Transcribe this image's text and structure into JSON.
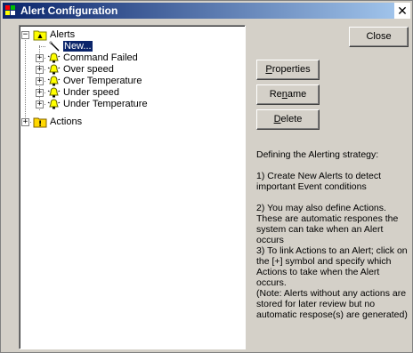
{
  "window": {
    "title": "Alert Configuration",
    "close_glyph": "✕"
  },
  "tree": {
    "root_alerts": "Alerts",
    "new_item": "New...",
    "alert_items": [
      "Command Failed",
      "Over speed",
      "Over Temperature",
      "Under speed",
      "Under Temperature"
    ],
    "root_actions": "Actions"
  },
  "buttons": {
    "close": "Close",
    "properties_pre": "",
    "properties_key": "P",
    "properties_post": "roperties",
    "rename_pre": "Re",
    "rename_key": "n",
    "rename_post": "ame",
    "delete_pre": "",
    "delete_key": "D",
    "delete_post": "elete"
  },
  "help": {
    "heading": "Defining the Alerting strategy:",
    "step1": "1) Create New Alerts to detect important Event conditions",
    "step2": "2) You may also define Actions. These are automatic respones the system can take when an Alert occurs",
    "step3": "3) To link Actions to an Alert; click on the [+] symbol and specify which Actions to take when the Alert occurs.",
    "note": "(Note: Alerts without any actions are stored for later review but no automatic respose(s) are generated)"
  },
  "colors": {
    "titlebar_start": "#0a246a",
    "titlebar_end": "#a6caf0",
    "dialog_face": "#d4d0c8",
    "alert_yellow": "#ffff00"
  },
  "icons": {
    "folder": "folder-alert-icon",
    "new": "wand-icon",
    "alert": "alert-bell-icon",
    "actions": "folder-actions-icon"
  }
}
